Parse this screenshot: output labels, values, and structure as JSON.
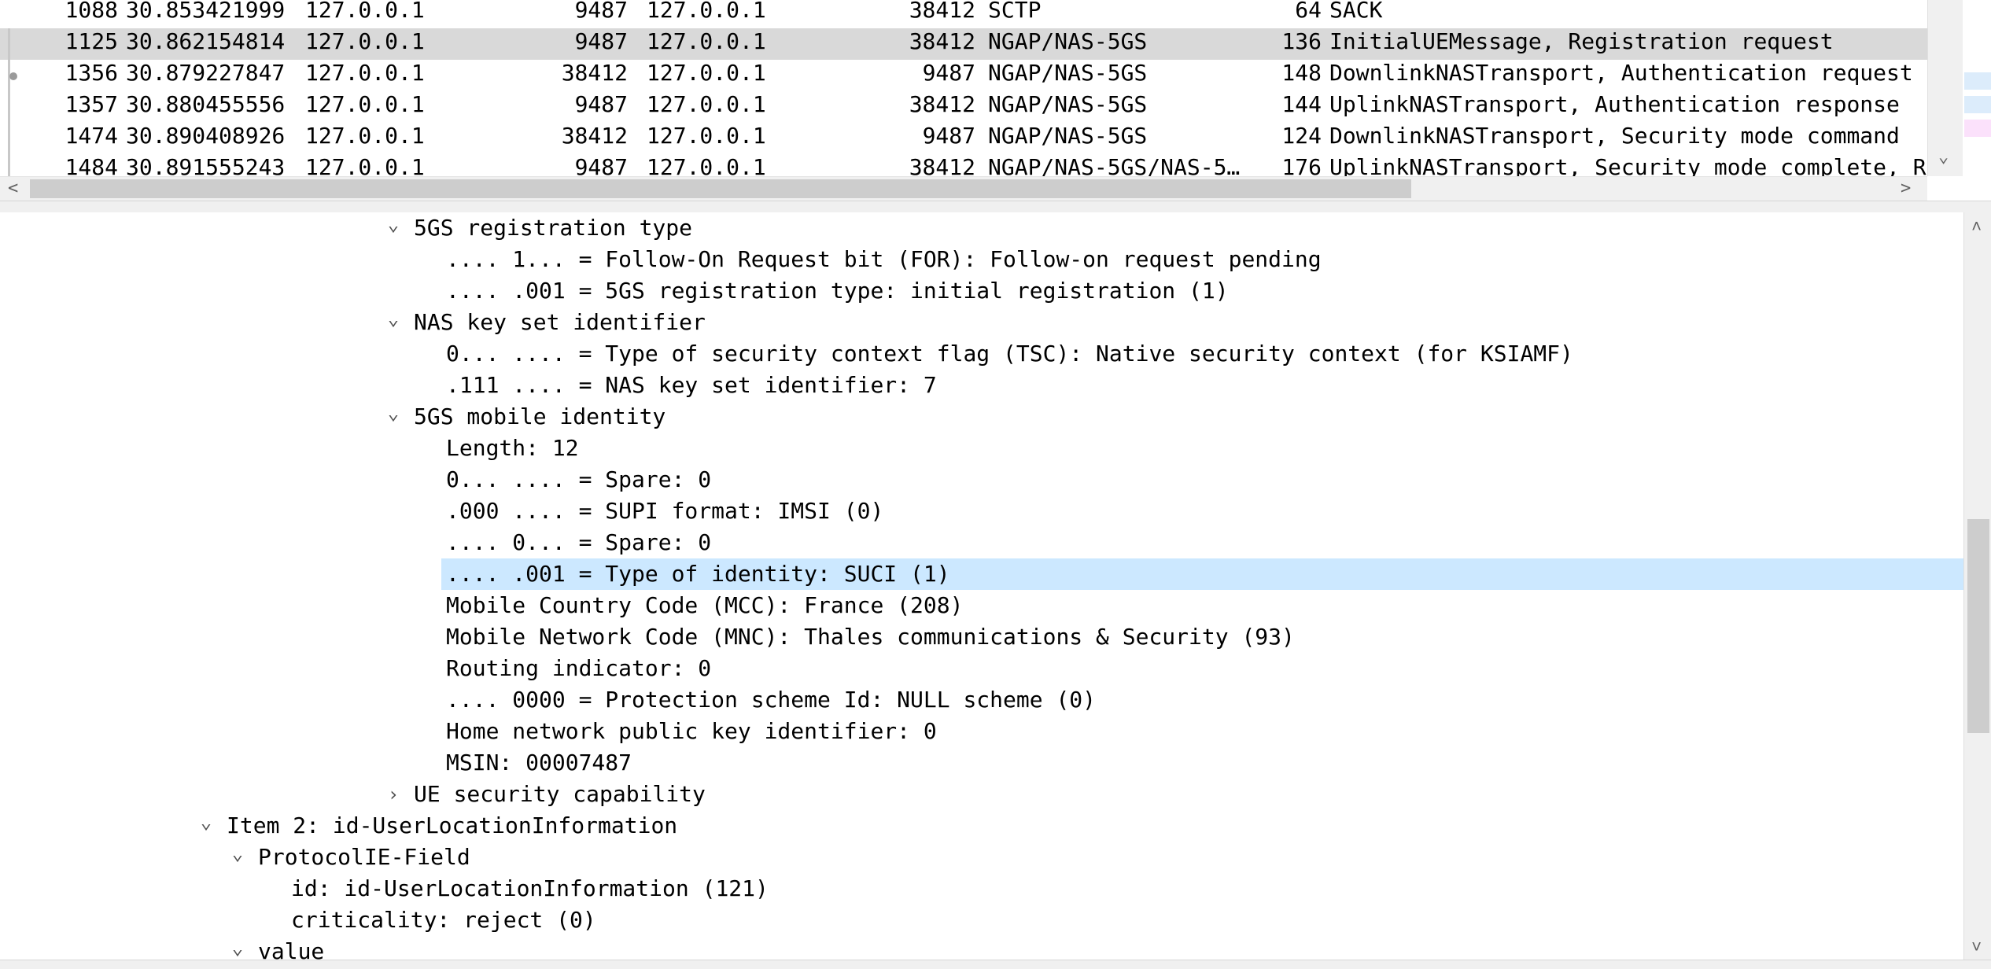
{
  "packet_list": {
    "rows": [
      {
        "no": "1088",
        "time": "30.853421999",
        "src": "127.0.0.1",
        "sport": "9487",
        "dst": "127.0.0.1",
        "dport": "38412",
        "proto": "SCTP",
        "len": "64",
        "info": "SACK"
      },
      {
        "no": "1125",
        "time": "30.862154814",
        "src": "127.0.0.1",
        "sport": "9487",
        "dst": "127.0.0.1",
        "dport": "38412",
        "proto": "NGAP/NAS-5GS",
        "len": "136",
        "info": "InitialUEMessage, Registration request"
      },
      {
        "no": "1356",
        "time": "30.879227847",
        "src": "127.0.0.1",
        "sport": "38412",
        "dst": "127.0.0.1",
        "dport": "9487",
        "proto": "NGAP/NAS-5GS",
        "len": "148",
        "info": "DownlinkNASTransport, Authentication request"
      },
      {
        "no": "1357",
        "time": "30.880455556",
        "src": "127.0.0.1",
        "sport": "9487",
        "dst": "127.0.0.1",
        "dport": "38412",
        "proto": "NGAP/NAS-5GS",
        "len": "144",
        "info": "UplinkNASTransport, Authentication response"
      },
      {
        "no": "1474",
        "time": "30.890408926",
        "src": "127.0.0.1",
        "sport": "38412",
        "dst": "127.0.0.1",
        "dport": "9487",
        "proto": "NGAP/NAS-5GS",
        "len": "124",
        "info": "DownlinkNASTransport, Security mode command"
      },
      {
        "no": "1484",
        "time": "30.891555243",
        "src": "127.0.0.1",
        "sport": "9487",
        "dst": "127.0.0.1",
        "dport": "38412",
        "proto": "NGAP/NAS-5GS/NAS-5…",
        "len": "176",
        "info": "UplinkNASTransport, Security mode complete, Re"
      }
    ],
    "selected_index": 1,
    "minimap_colors": [
      "#ffffff",
      "#dcecfb",
      "#dcecfb",
      "#fbe1fb"
    ]
  },
  "detail_tree": {
    "rows": [
      {
        "text": "5GS registration type",
        "level": 0,
        "toggle": "expanded"
      },
      {
        "text": ".... 1... = Follow-On Request bit (FOR): Follow-on request pending",
        "level": 1,
        "toggle": "none"
      },
      {
        "text": ".... .001 = 5GS registration type: initial registration (1)",
        "level": 1,
        "toggle": "none"
      },
      {
        "text": "NAS key set identifier",
        "level": 0,
        "toggle": "expanded"
      },
      {
        "text": "0... .... = Type of security context flag (TSC): Native security context (for KSIAMF)",
        "level": 1,
        "toggle": "none"
      },
      {
        "text": ".111 .... = NAS key set identifier: 7",
        "level": 1,
        "toggle": "none"
      },
      {
        "text": "5GS mobile identity",
        "level": 0,
        "toggle": "expanded"
      },
      {
        "text": "Length: 12",
        "level": 1,
        "toggle": "none"
      },
      {
        "text": "0... .... = Spare: 0",
        "level": 1,
        "toggle": "none"
      },
      {
        "text": ".000 .... = SUPI format: IMSI (0)",
        "level": 1,
        "toggle": "none"
      },
      {
        "text": ".... 0... = Spare: 0",
        "level": 1,
        "toggle": "none"
      },
      {
        "text": ".... .001 = Type of identity: SUCI (1)",
        "level": 1,
        "toggle": "none",
        "selected": true
      },
      {
        "text": "Mobile Country Code (MCC): France (208)",
        "level": 1,
        "toggle": "none"
      },
      {
        "text": "Mobile Network Code (MNC): Thales communications & Security (93)",
        "level": 1,
        "toggle": "none"
      },
      {
        "text": "Routing indicator: 0",
        "level": 1,
        "toggle": "none"
      },
      {
        "text": ".... 0000 = Protection scheme Id: NULL scheme (0)",
        "level": 1,
        "toggle": "none"
      },
      {
        "text": "Home network public key identifier: 0",
        "level": 1,
        "toggle": "none"
      },
      {
        "text": "MSIN: 00007487",
        "level": 1,
        "toggle": "none"
      },
      {
        "text": "UE security capability",
        "level": 0,
        "toggle": "collapsed"
      },
      {
        "text": "Item 2: id-UserLocationInformation",
        "level": -6,
        "toggle": "expanded"
      },
      {
        "text": "ProtocolIE-Field",
        "level": -5,
        "toggle": "expanded"
      },
      {
        "text": "id: id-UserLocationInformation (121)",
        "level": -4,
        "toggle": "none"
      },
      {
        "text": "criticality: reject (0)",
        "level": -4,
        "toggle": "none"
      },
      {
        "text": "value",
        "level": -5,
        "toggle": "expanded"
      }
    ]
  },
  "icons": {
    "expanded": "chevron-down-icon",
    "collapsed": "chevron-right-icon",
    "scroll_up": "arrow-up-icon",
    "scroll_down": "arrow-down-icon",
    "scroll_left": "arrow-left-icon",
    "scroll_right": "arrow-right-icon"
  },
  "colors": {
    "selected_packet_row": "#d9d9d9",
    "selected_detail_row": "#cce8ff"
  }
}
